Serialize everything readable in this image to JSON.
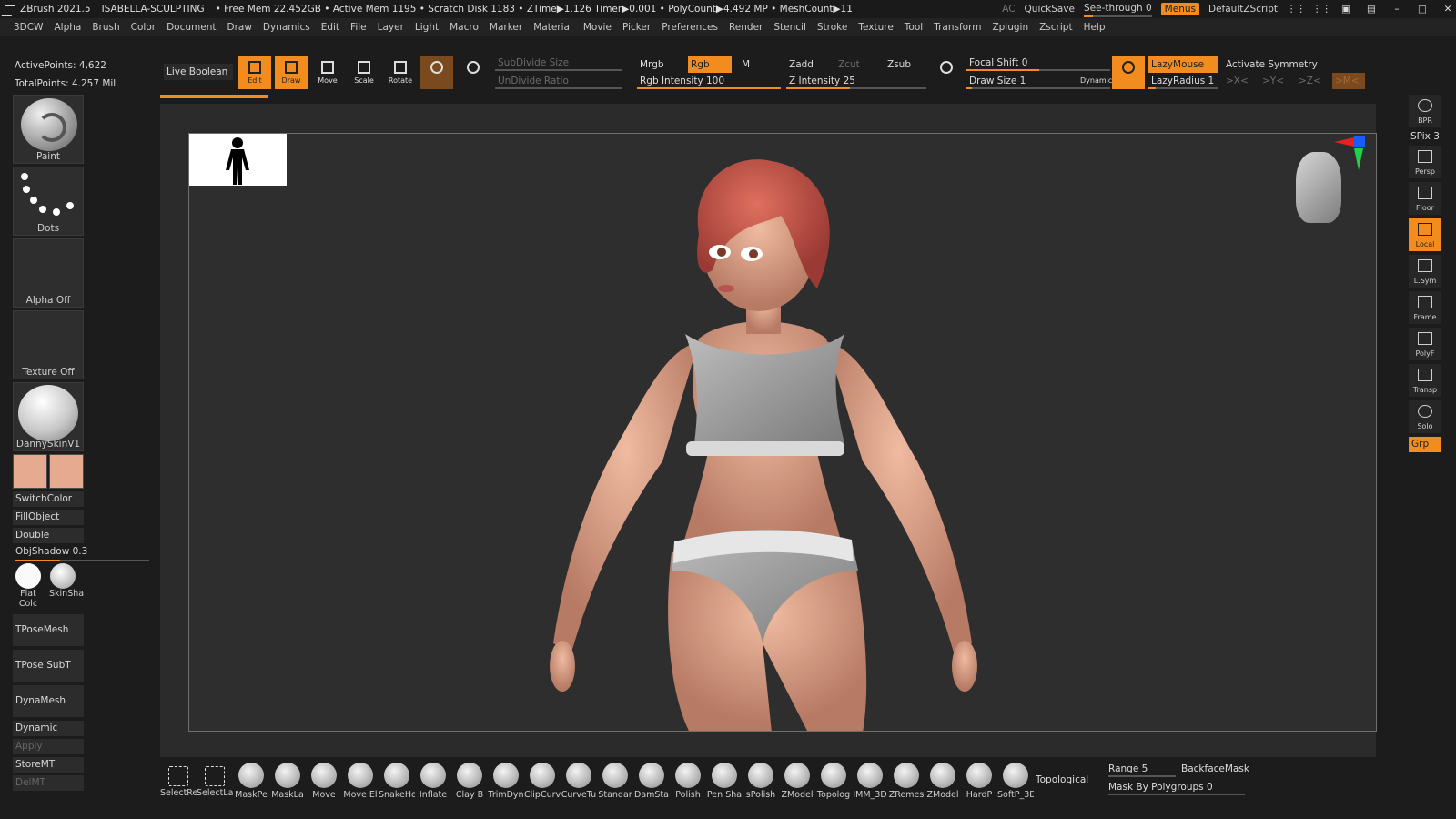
{
  "titlebar": {
    "app": "ZBrush 2021.5",
    "project": "ISABELLA-SCULPTING",
    "stats": "• Free Mem 22.452GB • Active Mem 1195 • Scratch Disk 1183 • ZTime▶1.126 Timer▶0.001 • PolyCount▶4.492 MP • MeshCount▶11",
    "ac": "AC",
    "quicksave": "QuickSave",
    "see_through": "See-through  0",
    "menus": "Menus",
    "script": "DefaultZScript"
  },
  "menus": [
    "3DCW",
    "Alpha",
    "Brush",
    "Color",
    "Document",
    "Draw",
    "Dynamics",
    "Edit",
    "File",
    "Layer",
    "Light",
    "Macro",
    "Marker",
    "Material",
    "Movie",
    "Picker",
    "Preferences",
    "Render",
    "Stencil",
    "Stroke",
    "Texture",
    "Tool",
    "Transform",
    "Zplugin",
    "Zscript",
    "Help"
  ],
  "info": {
    "active_points": "ActivePoints: 4,622",
    "total_points": "TotalPoints: 4.257 Mil"
  },
  "left": {
    "paint": "Paint",
    "dots": "Dots",
    "alpha": "Alpha Off",
    "texture": "Texture Off",
    "material": "DannySkinV1",
    "switch_color": "SwitchColor",
    "fill_object": "FillObject",
    "double": "Double",
    "obj_shadow": "ObjShadow 0.3",
    "flat_color": "Flat Colc",
    "skin_shade": "SkinSha",
    "tpose_mesh": "TPoseMesh",
    "tpose_subt": "TPose|SubT",
    "dynamesh": "DynaMesh",
    "dynamic": "Dynamic",
    "apply": "Apply",
    "store_mt": "StoreMT",
    "del_mt": "DelMT"
  },
  "toolbar": {
    "live_boolean": "Live Boolean",
    "edit": "Edit",
    "draw": "Draw",
    "move": "Move",
    "scale": "Scale",
    "rotate": "Rotate",
    "subdivide_size": "SubDivide Size",
    "undivide_ratio": "UnDivide Ratio",
    "mrgb": "Mrgb",
    "rgb": "Rgb",
    "m": "M",
    "rgb_intensity": "Rgb Intensity 100",
    "zadd": "Zadd",
    "zcut": "Zcut",
    "zsub": "Zsub",
    "z_intensity": "Z Intensity 25",
    "focal_shift": "Focal Shift 0",
    "draw_size": "Draw Size 1",
    "dynamic": "Dynamic",
    "lazymouse": "LazyMouse",
    "lazyradius": "LazyRadius 1",
    "activate_symmetry": "Activate Symmetry",
    "sym_x": ">X<",
    "sym_y": ">Y<",
    "sym_z": ">Z<",
    "sym_m": ">M<"
  },
  "right": {
    "bpr": "BPR",
    "spix": "SPix 3",
    "persp": "Persp",
    "floor": "Floor",
    "local": "Local",
    "lsym": "L.Sym",
    "frame": "Frame",
    "polyf": "PolyF",
    "transp": "Transp",
    "solo": "Solo",
    "grp": "Grp"
  },
  "bottom": {
    "brushes": [
      "SelectRe",
      "SelectLa",
      "MaskPe",
      "MaskLa",
      "Move",
      "Move El",
      "SnakeHo",
      "Inflate",
      "Clay B",
      "TrimDyn",
      "ClipCurv",
      "CurveTu",
      "Standar",
      "DamSta",
      "Polish",
      "Pen Sha",
      "sPolish",
      "ZModel",
      "Topolog",
      "IMM_3D",
      "ZRemes",
      "ZModel",
      "HardP",
      "SoftP_3D"
    ],
    "topological": "Topological",
    "range": "Range 5",
    "backface_mask": "BackfaceMask",
    "mask_by_polygroups": "Mask By Polygroups 0"
  },
  "colors": {
    "accent": "#f28c1e",
    "skin": "#e5aa90",
    "hair": "#c85048"
  }
}
